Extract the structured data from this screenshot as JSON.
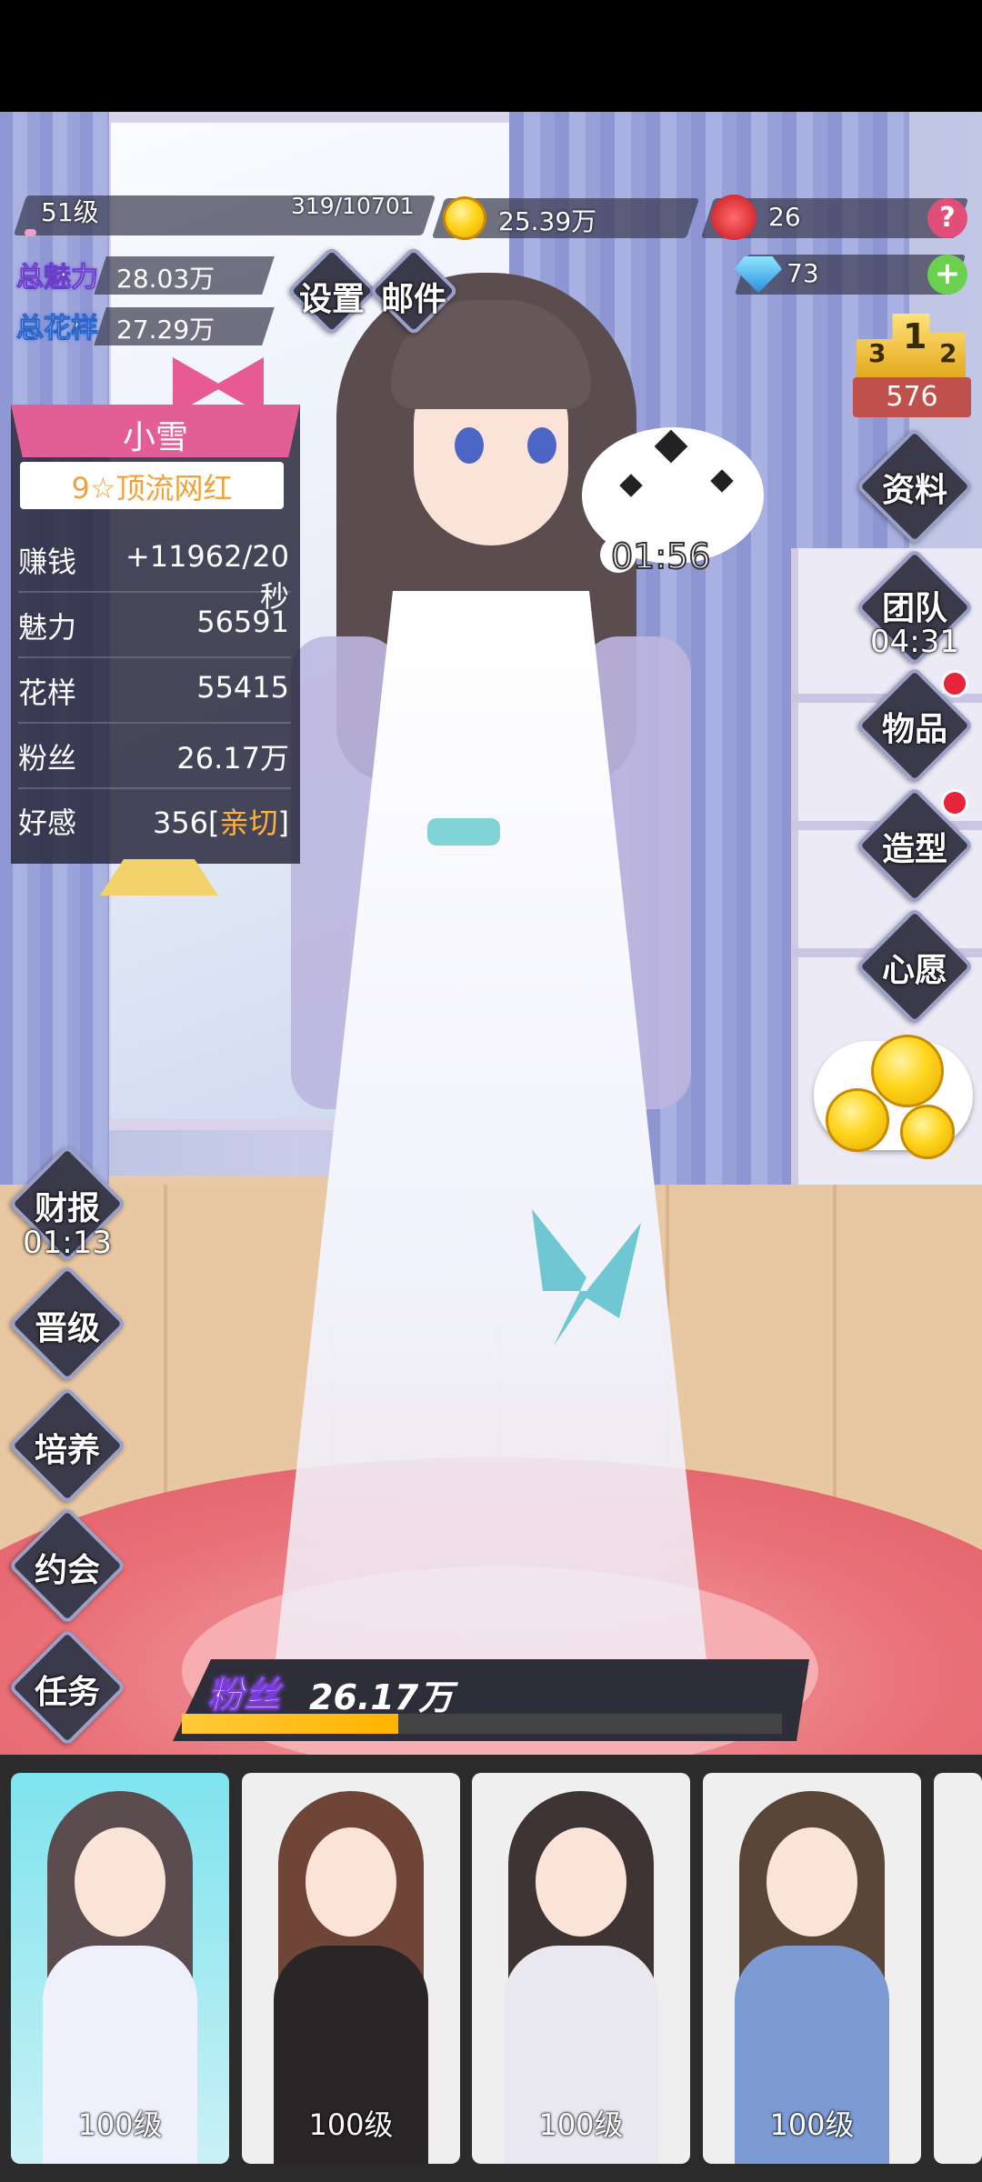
{
  "top": {
    "level": "51级",
    "exp": "319/10701",
    "exp_ratio": 0.03,
    "gold": "25.39万",
    "roses": "26",
    "diamonds": "73",
    "help_icon": "?",
    "add_icon": "+"
  },
  "stats": {
    "charm_label": "总魅力",
    "charm_value": "28.03万",
    "style_label": "总花样",
    "style_value": "27.29万"
  },
  "menu_top": {
    "settings": "设置",
    "mail": "邮件"
  },
  "ranking": {
    "digits": [
      "3",
      "1",
      "2"
    ],
    "value": "576"
  },
  "profile": {
    "name": "小雪",
    "rank": "9☆顶流网红",
    "rows": [
      {
        "label": "赚钱",
        "value": "+11962/20秒"
      },
      {
        "label": "魅力",
        "value": "56591"
      },
      {
        "label": "花样",
        "value": "55415"
      },
      {
        "label": "粉丝",
        "value": "26.17万"
      },
      {
        "label": "好感",
        "value": "356[",
        "extra": "亲切",
        "tail": "]"
      }
    ]
  },
  "bubble": {
    "timer": "01:56"
  },
  "right_buttons": [
    {
      "label": "资料"
    },
    {
      "label": "团队",
      "timer": "04:31"
    },
    {
      "label": "物品"
    },
    {
      "label": "造型"
    },
    {
      "label": "心愿"
    }
  ],
  "left_buttons": [
    {
      "label": "财报",
      "timer": "01:13"
    },
    {
      "label": "晋级"
    },
    {
      "label": "培养"
    },
    {
      "label": "约会"
    },
    {
      "label": "任务"
    }
  ],
  "fans": {
    "label": "粉丝",
    "value": "26.17万",
    "progress": 0.36
  },
  "cards": [
    {
      "level": "100级"
    },
    {
      "level": "100级"
    },
    {
      "level": "100级"
    },
    {
      "level": "100级"
    }
  ],
  "colors": {
    "accent_pink": "#e35d97",
    "gold": "#ffc93a",
    "affection": "#ffb13b"
  }
}
